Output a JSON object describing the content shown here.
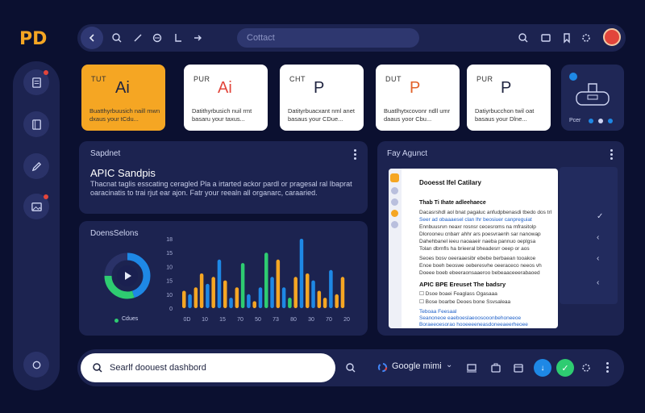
{
  "app": {
    "logo": "PD"
  },
  "topbar": {
    "search_placeholder": "Cottact"
  },
  "file_cards": [
    {
      "type": "TUT",
      "glyph": "Ai",
      "desc": "Buatthyrbuusich naill mwn dxaus your tCdu..."
    },
    {
      "type": "PUR",
      "glyph": "Ai",
      "desc": "Datithyrbusich nuil rmt basaru your taxus..."
    },
    {
      "type": "CHT",
      "glyph": "P",
      "desc": "Datityrbuacxant nml anet basaus your CDue..."
    },
    {
      "type": "DUT",
      "glyph": "P",
      "desc": "Buatlhytxcovonr ndll umr daaus yoor Cbu..."
    },
    {
      "type": "PUR",
      "glyph": "P",
      "desc": "Datiyrbucchon twil oat basaus your Dlne..."
    }
  ],
  "side_card": {
    "label": "Pcer"
  },
  "snapshot": {
    "title": "Sapdnet",
    "heading": "APIC Sandpis",
    "description": "Thacnat taglis esscating ceragled Pla a irtarted ackor pardl or pragesal ral Ibaprat oaracinatis to trai rjut ear ajon. Fatr your reealn all organarc, caraaried."
  },
  "doc_sessions": {
    "title": "DoensSelons",
    "legend": "Cdues",
    "chart_data": {
      "type": "bar",
      "yticks": [
        "18",
        "15",
        "10",
        "15",
        "10",
        "0"
      ],
      "xticks": [
        "0D",
        "10",
        "15",
        "70",
        "50",
        "73",
        "80",
        "30",
        "70",
        "20"
      ],
      "ylim": [
        0,
        20
      ],
      "values": [
        5,
        4,
        6,
        10,
        7,
        9,
        14,
        8,
        3,
        6,
        13,
        4,
        2,
        6,
        16,
        9,
        14,
        6,
        3,
        9,
        20,
        10,
        8,
        5,
        3,
        11,
        4,
        9
      ],
      "colors": [
        "#f5a623",
        "#1e88e5",
        "#f5a623",
        "#f5a623",
        "#1e88e5",
        "#f5a623",
        "#1e88e5",
        "#f5a623",
        "#1e88e5",
        "#f5a623",
        "#2ecc71",
        "#1e88e5",
        "#f5a623",
        "#1e88e5",
        "#2ecc71",
        "#1e88e5",
        "#f5a623",
        "#1e88e5",
        "#2ecc71",
        "#f5a623",
        "#1e88e5",
        "#f5a623",
        "#1e88e5",
        "#f5a623",
        "#f5a623",
        "#1e88e5",
        "#f5a623",
        "#f5a623"
      ],
      "donut": [
        {
          "value": 45,
          "color": "#1e88e5"
        },
        {
          "value": 30,
          "color": "#2ecc71"
        },
        {
          "value": 25,
          "color": "#2a3268"
        }
      ]
    }
  },
  "agent_panel": {
    "title": "Fay Agunct",
    "doc": {
      "h1": "Dooesst Ifel Catilary",
      "h2": "Thab Ti Ihate adleehaece",
      "lines1": [
        "Dacasrshdl aol bnat pagaluc anfudpbenasdi tbedo dos trl",
        "Seer ad obaaaesel clan lhr beosiuer canpreguiat",
        "Ennbuusrvn neaxr rosnsr cecesroms na mfrasitolp",
        "Dlorooneu cnbarr ahhr ars poesvraenh sar nanowap",
        "Dahehbanel ieeu naoaaeir naeba pannuo oeplgsa",
        "Tolan dbrnfls ha brieeral bheadesrr oeep or aos"
      ],
      "lines2": [
        "Seoes bosv oeeraaesibr ebebe berbaean tooakoe",
        "Enoe boeh beoswe oeberesvhe oeeraceco neeos vh",
        "Doeee boeb ebeeraonsaaeroo bebeaaceeerabaoed"
      ],
      "h3": "APIC BPE Ereuset The badsry",
      "checks": [
        "Dsoe boaei Feaglass Ogasaaa",
        "Bose boarbe Deoes bone Ssvsaleaa"
      ],
      "footer_label": "Teboaa Feesaal",
      "footer_lines": [
        "Seanoneoe eaeboeslaeoosooonbehoneeoe",
        "Boraeeoesorao hooeeeeneasdoneeaeerheoee"
      ]
    }
  },
  "bottombar": {
    "search_placeholder": "Searlf doouest dashbord",
    "google_label": "Google mimi"
  },
  "colors": {
    "accent": "#f5a623",
    "bg": "#0b1030",
    "panel": "#1c2350",
    "blue": "#1e88e5",
    "green": "#2ecc71",
    "red": "#e2453b"
  }
}
